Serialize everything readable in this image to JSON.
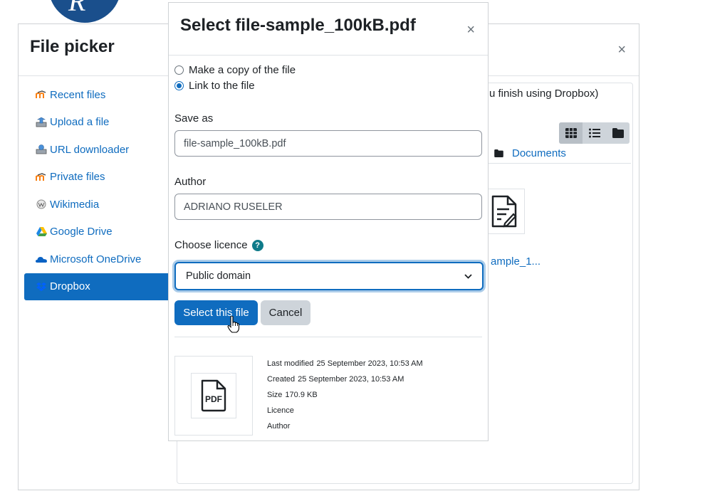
{
  "filepicker": {
    "title": "File picker",
    "close_symbol": "×",
    "sidebar": [
      {
        "label": "Recent files",
        "icon": "moodle-icon"
      },
      {
        "label": "Upload a file",
        "icon": "upload-icon"
      },
      {
        "label": "URL downloader",
        "icon": "url-icon"
      },
      {
        "label": "Private files",
        "icon": "moodle-icon"
      },
      {
        "label": "Wikimedia",
        "icon": "wikimedia-icon"
      },
      {
        "label": "Google Drive",
        "icon": "google-drive-icon"
      },
      {
        "label": "Microsoft OneDrive",
        "icon": "onedrive-icon"
      },
      {
        "label": "Dropbox",
        "icon": "dropbox-icon",
        "active": true
      }
    ],
    "content": {
      "notice": "u finish using Dropbox)",
      "path_folder": "Documents",
      "file_label": "ample_1..."
    }
  },
  "select_dialog": {
    "title": "Select file-sample_100kB.pdf",
    "close_symbol": "×",
    "options": [
      {
        "label": "Make a copy of the file",
        "checked": false
      },
      {
        "label": "Link to the file",
        "checked": true
      }
    ],
    "save_as_label": "Save as",
    "save_as_value": "file-sample_100kB.pdf",
    "author_label": "Author",
    "author_value": "ADRIANO RUSELER",
    "licence_label": "Choose licence",
    "licence_value": "Public domain",
    "select_button": "Select this file",
    "cancel_button": "Cancel",
    "pdf_label": "PDF",
    "meta": {
      "last_modified_label": "Last modified",
      "last_modified_value": "25 September 2023, 10:53 AM",
      "created_label": "Created",
      "created_value": "25 September 2023, 10:53 AM",
      "size_label": "Size",
      "size_value": "170.9 KB",
      "licence_label": "Licence",
      "author_label": "Author"
    }
  },
  "colors": {
    "primary": "#0f6cbf",
    "secondary": "#ced4da",
    "logo": "#1a4f8c"
  }
}
